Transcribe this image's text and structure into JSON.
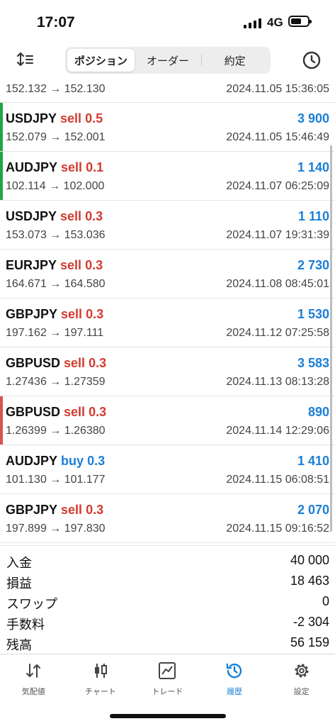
{
  "status_bar": {
    "time": "17:07",
    "network": "4G"
  },
  "segments": [
    {
      "label": "ポジション",
      "active": true
    },
    {
      "label": "オーダー",
      "active": false
    },
    {
      "label": "約定",
      "active": false
    }
  ],
  "rows": [
    {
      "pair": "",
      "side": "",
      "side_type": "",
      "lots": "",
      "profit": "",
      "prices": "152.132 → 152.130",
      "date": "2024.11.05 15:36:05",
      "marker_color": ""
    },
    {
      "pair": "USDJPY",
      "side": "sell",
      "side_type": "sell",
      "lots": "0.5",
      "profit": "3 900",
      "prices": "152.079 → 152.001",
      "date": "2024.11.05 15:46:49",
      "marker_color": "#22a644"
    },
    {
      "pair": "AUDJPY",
      "side": "sell",
      "side_type": "sell",
      "lots": "0.1",
      "profit": "1 140",
      "prices": "102.114 → 102.000",
      "date": "2024.11.07 06:25:09",
      "marker_color": "#22a644"
    },
    {
      "pair": "USDJPY",
      "side": "sell",
      "side_type": "sell",
      "lots": "0.3",
      "profit": "1 110",
      "prices": "153.073 → 153.036",
      "date": "2024.11.07 19:31:39",
      "marker_color": ""
    },
    {
      "pair": "EURJPY",
      "side": "sell",
      "side_type": "sell",
      "lots": "0.3",
      "profit": "2 730",
      "prices": "164.671 → 164.580",
      "date": "2024.11.08 08:45:01",
      "marker_color": ""
    },
    {
      "pair": "GBPJPY",
      "side": "sell",
      "side_type": "sell",
      "lots": "0.3",
      "profit": "1 530",
      "prices": "197.162 → 197.111",
      "date": "2024.11.12 07:25:58",
      "marker_color": ""
    },
    {
      "pair": "GBPUSD",
      "side": "sell",
      "side_type": "sell",
      "lots": "0.3",
      "profit": "3 583",
      "prices": "1.27436 → 1.27359",
      "date": "2024.11.13 08:13:28",
      "marker_color": ""
    },
    {
      "pair": "GBPUSD",
      "side": "sell",
      "side_type": "sell",
      "lots": "0.3",
      "profit": "890",
      "prices": "1.26399 → 1.26380",
      "date": "2024.11.14 12:29:06",
      "marker_color": "#d9534f"
    },
    {
      "pair": "AUDJPY",
      "side": "buy",
      "side_type": "buy",
      "lots": "0.3",
      "profit": "1 410",
      "prices": "101.130 → 101.177",
      "date": "2024.11.15 06:08:51",
      "marker_color": ""
    },
    {
      "pair": "GBPJPY",
      "side": "sell",
      "side_type": "sell",
      "lots": "0.3",
      "profit": "2 070",
      "prices": "197.899 → 197.830",
      "date": "2024.11.15 09:16:52",
      "marker_color": ""
    }
  ],
  "summary": [
    {
      "label": "入金",
      "value": "40 000"
    },
    {
      "label": "損益",
      "value": "18 463"
    },
    {
      "label": "スワップ",
      "value": "0"
    },
    {
      "label": "手数料",
      "value": "-2 304"
    },
    {
      "label": "残高",
      "value": "56 159"
    }
  ],
  "tabs": [
    {
      "label": "気配値",
      "icon": "quotes-icon",
      "active": false
    },
    {
      "label": "チャート",
      "icon": "chart-icon",
      "active": false
    },
    {
      "label": "トレード",
      "icon": "trade-icon",
      "active": false
    },
    {
      "label": "履歴",
      "icon": "history-icon",
      "active": true
    },
    {
      "label": "設定",
      "icon": "settings-icon",
      "active": false
    }
  ],
  "colors": {
    "accent": "#1a7fd6",
    "sell": "#d23b2e",
    "buy": "#1a7fd6",
    "profit_marker": "#22a644",
    "loss_marker": "#d9534f"
  }
}
